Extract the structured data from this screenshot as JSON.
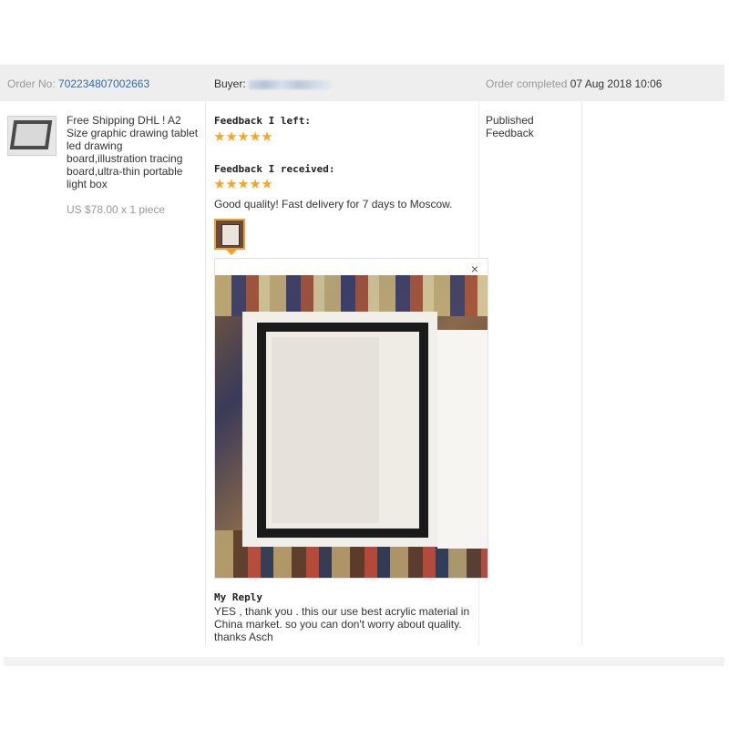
{
  "order": {
    "number_label": "Order No:",
    "number": "702234807002663",
    "buyer_label": "Buyer:",
    "completed_label": "Order completed",
    "completed_date": "07 Aug 2018 10:06"
  },
  "product": {
    "title": "Free Shipping DHL ! A2 Size graphic drawing tablet led drawing board,illustration tracing board,ultra-thin portable light box",
    "price": "US $78.00 x 1 piece",
    "thumbnail_icon": "tablet-thumbnail"
  },
  "feedback": {
    "left_label": "Feedback I left:",
    "left_stars": 5,
    "received_label": "Feedback I received:",
    "received_stars": 5,
    "review_text": "Good quality! Fast delivery for 7 days to Moscow.",
    "star_color": "#f5a623",
    "close_symbol": "×"
  },
  "reply": {
    "title": "My Reply",
    "text": "YES , thank you . this our use best acrylic material in China market. so you can don't worry about quality. thanks Asch"
  },
  "status": {
    "text": "Published Feedback"
  },
  "colors": {
    "header_bg": "#eeeeee",
    "link": "#2b6cb0",
    "highlight_border": "#f0a030"
  }
}
